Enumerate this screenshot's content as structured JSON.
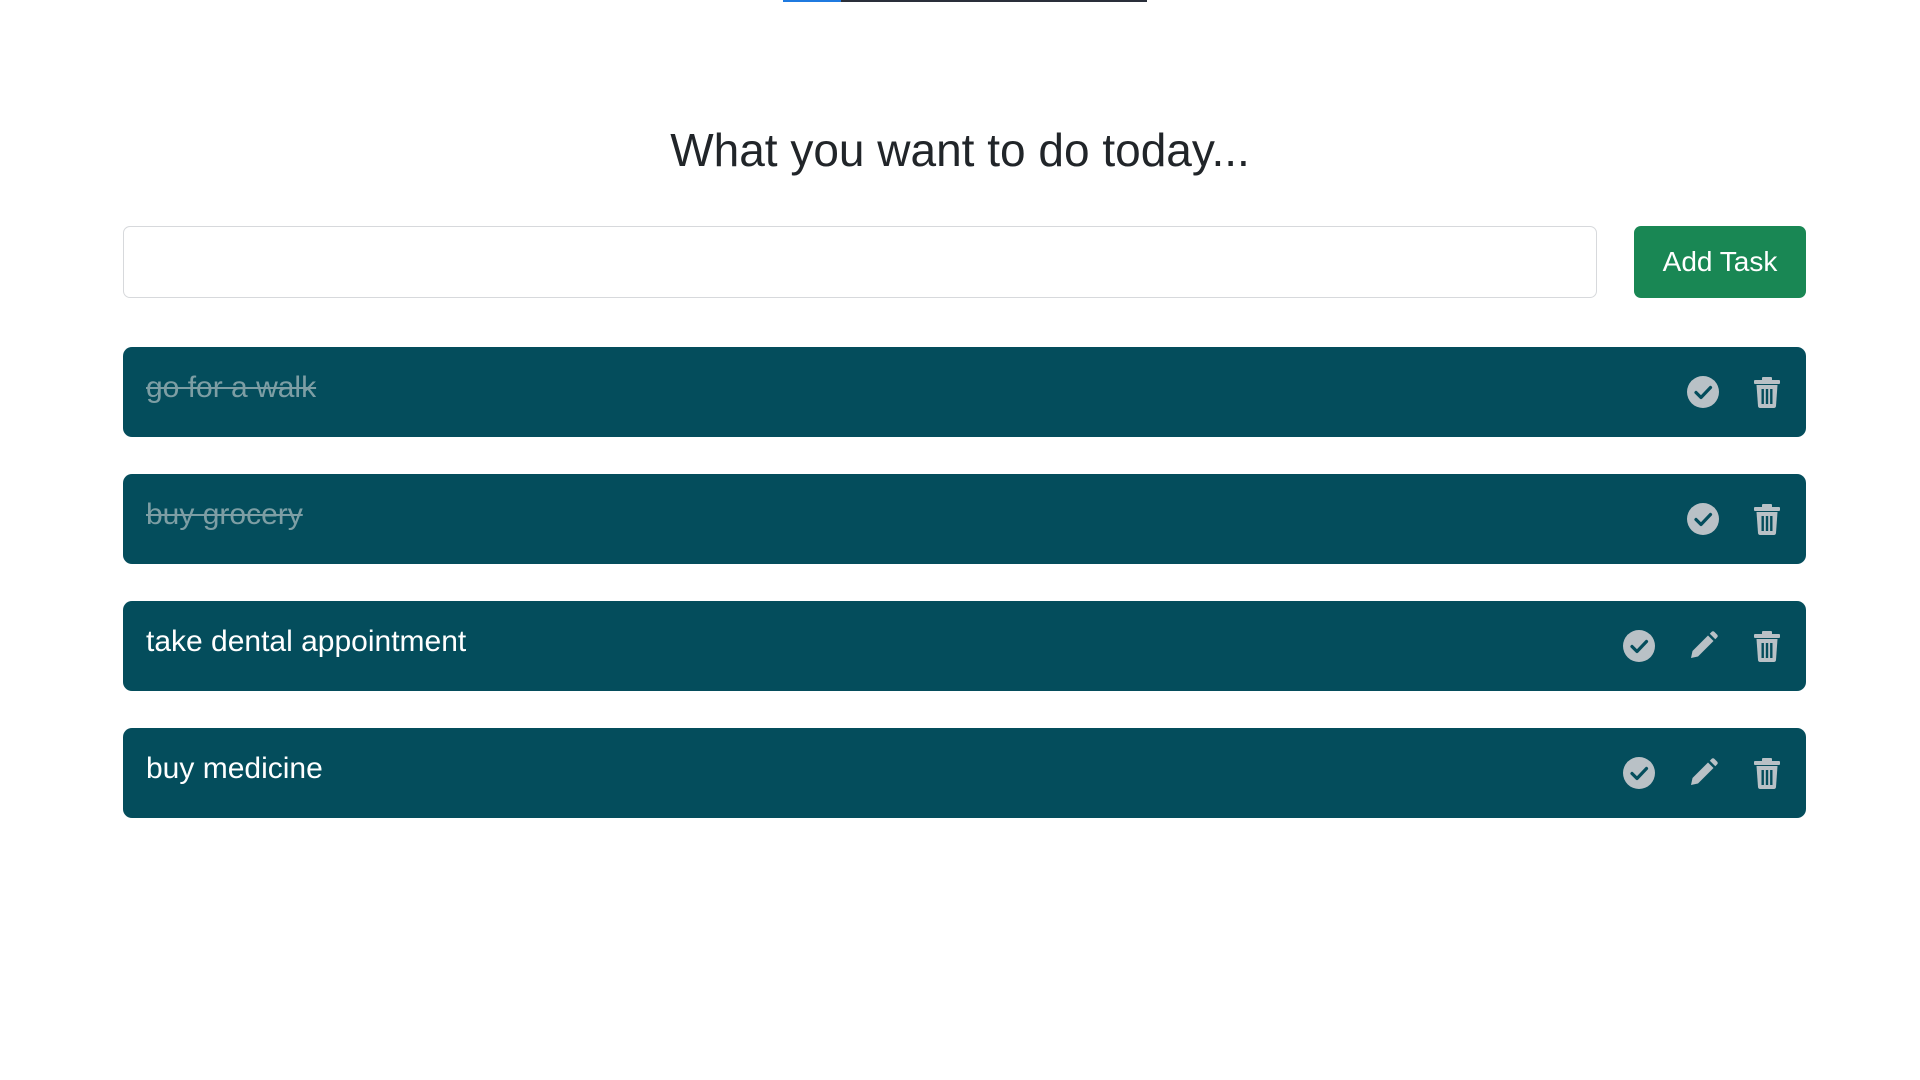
{
  "progress": {
    "value": 0.16
  },
  "header": {
    "title": "What you want to do today..."
  },
  "form": {
    "input_value": "",
    "input_placeholder": "",
    "add_label": "Add Task"
  },
  "colors": {
    "task_bg": "#044d5c",
    "add_button": "#198754",
    "icon": "#b9c1c6",
    "progress_fill": "#1f7ae0"
  },
  "tasks": [
    {
      "text": "go for a walk",
      "completed": true,
      "icons": [
        "check-circle-icon",
        "trash-icon"
      ]
    },
    {
      "text": "buy grocery",
      "completed": true,
      "icons": [
        "check-circle-icon",
        "trash-icon"
      ]
    },
    {
      "text": "take dental appointment",
      "completed": false,
      "icons": [
        "check-circle-icon",
        "pencil-icon",
        "trash-icon"
      ]
    },
    {
      "text": "buy medicine",
      "completed": false,
      "icons": [
        "check-circle-icon",
        "pencil-icon",
        "trash-icon"
      ]
    }
  ]
}
